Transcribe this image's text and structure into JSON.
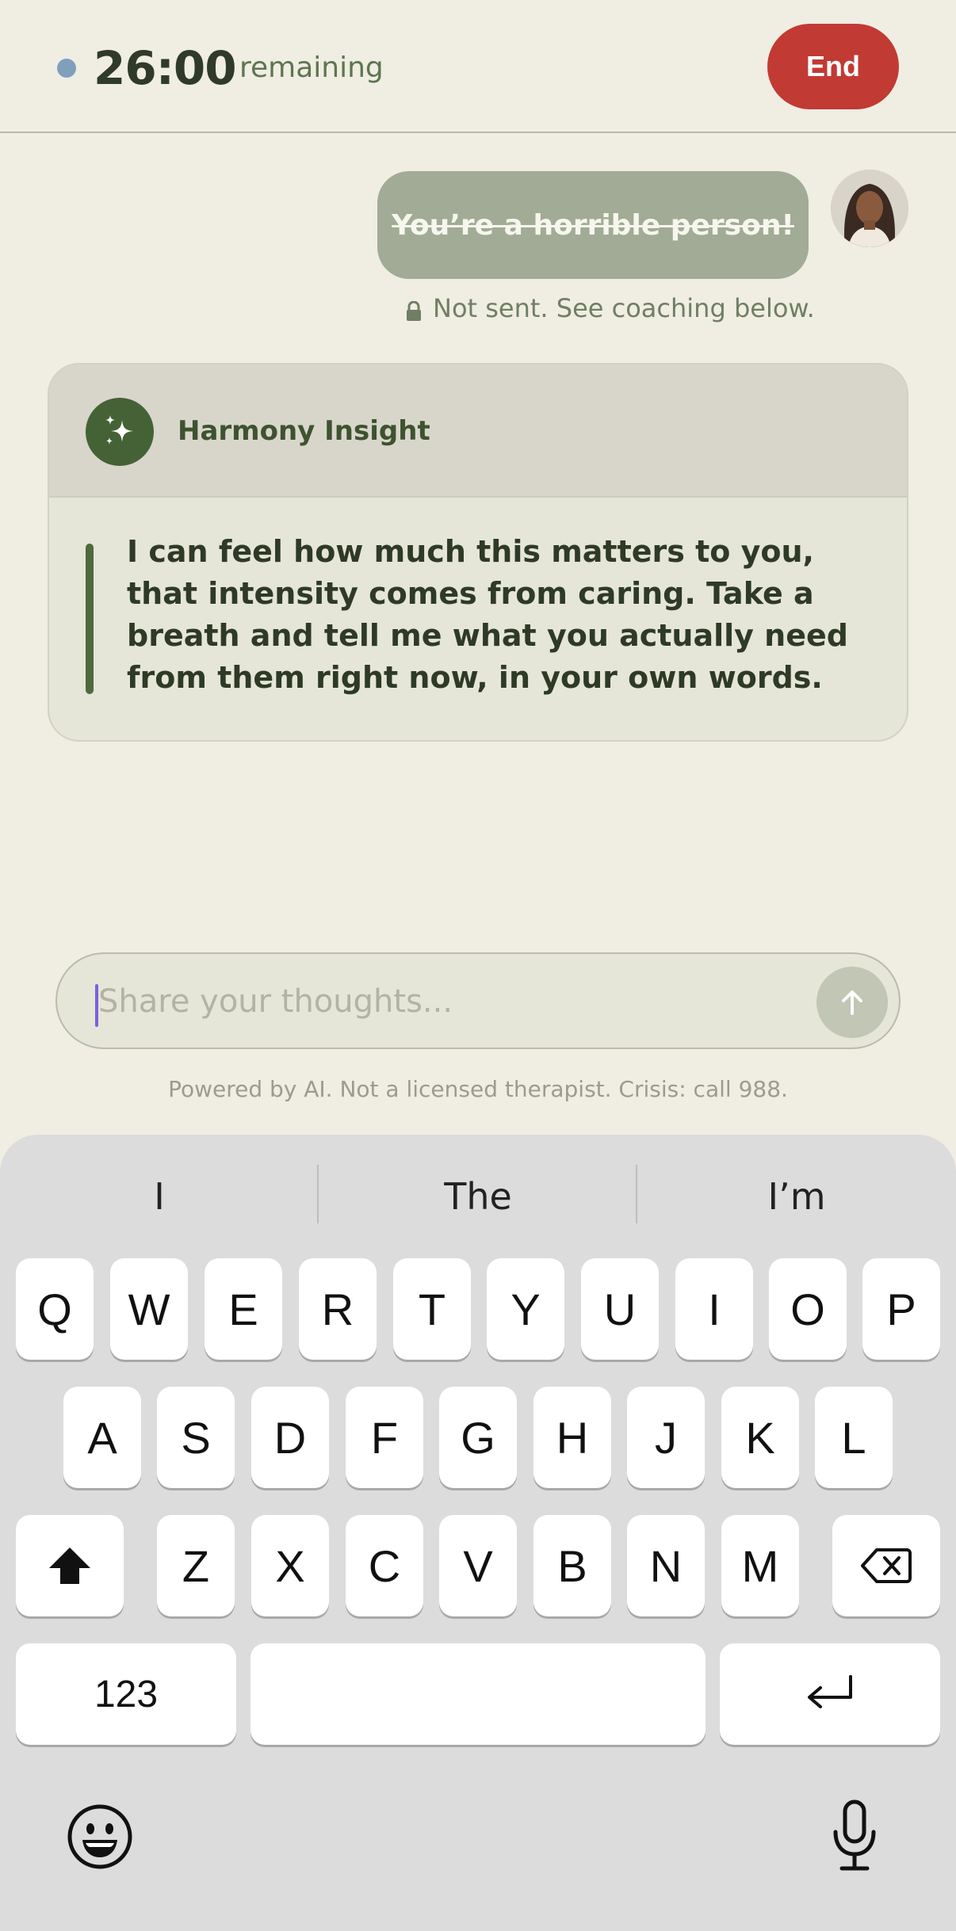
{
  "header": {
    "timer": "26:00",
    "remaining_label": "remaining",
    "end_label": "End"
  },
  "message": {
    "text": "You’re a horrible person!",
    "status": "Not sent. See coaching below."
  },
  "insight": {
    "title": "Harmony Insight",
    "body": "I can feel how much this matters to you, that intensity comes from caring. Take a breath and tell me what you actually need from them right now, in your own words."
  },
  "composer": {
    "placeholder": "Share your thoughts...",
    "value": ""
  },
  "disclaimer": "Powered by AI. Not a licensed therapist. Crisis: call 988.",
  "keyboard": {
    "suggestions": [
      "I",
      "The",
      "I’m"
    ],
    "row1": [
      "Q",
      "W",
      "E",
      "R",
      "T",
      "Y",
      "U",
      "I",
      "O",
      "P"
    ],
    "row2": [
      "A",
      "S",
      "D",
      "F",
      "G",
      "H",
      "J",
      "K",
      "L"
    ],
    "row3": [
      "Z",
      "X",
      "C",
      "V",
      "B",
      "N",
      "M"
    ],
    "numbers_label": "123",
    "icons": [
      "shift-icon",
      "backspace-icon",
      "return-icon",
      "emoji-icon",
      "microphone-icon"
    ]
  },
  "colors": {
    "accent_green": "#456236",
    "end_red": "#c23a34",
    "bubble": "#a1ab95",
    "caret": "#7b61e0"
  }
}
